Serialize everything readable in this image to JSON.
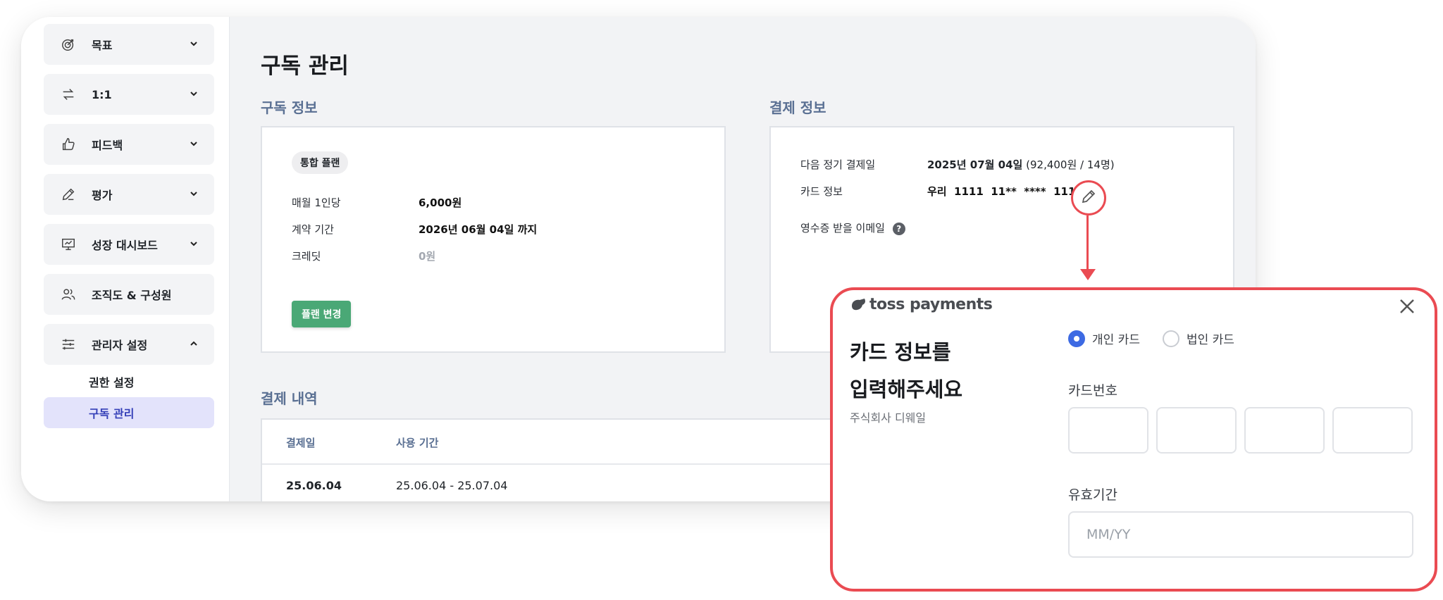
{
  "sidebar": {
    "items": [
      {
        "label": "목표",
        "icon": "target-icon",
        "expanded": false
      },
      {
        "label": "1:1",
        "icon": "swap-arrows-icon",
        "expanded": false
      },
      {
        "label": "피드백",
        "icon": "thumbs-up-icon",
        "expanded": false
      },
      {
        "label": "평가",
        "icon": "edit-pen-icon",
        "expanded": false
      },
      {
        "label": "성장 대시보드",
        "icon": "presentation-board-icon",
        "expanded": false
      },
      {
        "label": "조직도 & 구성원",
        "icon": "users-icon"
      },
      {
        "label": "관리자 설정",
        "icon": "sliders-icon",
        "expanded": true
      }
    ],
    "sub_items": [
      {
        "label": "권한 설정",
        "active": false
      },
      {
        "label": "구독 관리",
        "active": true
      }
    ]
  },
  "page": {
    "title": "구독 관리"
  },
  "subscription": {
    "section_title": "구독 정보",
    "plan_badge": "통합 플랜",
    "rows": [
      {
        "label": "매월 1인당",
        "value": "6,000원"
      },
      {
        "label": "계약 기간",
        "value": "2026년 06월 04일 까지"
      },
      {
        "label": "크레딧",
        "value": "0원"
      }
    ],
    "change_button": "플랜 변경"
  },
  "payment": {
    "section_title": "결제 정보",
    "next_payment_label": "다음 정기 결제일",
    "next_payment_date": "2025년 07월 04일",
    "next_payment_detail": "(92,400원 / 14명)",
    "card_label": "카드 정보",
    "card_value": "우리  1111  11**  ****  1111",
    "receipt_label": "영수증 받을 이메일",
    "help_glyph": "?"
  },
  "history": {
    "section_title": "결제 내역",
    "columns": [
      "결제일",
      "사용 기간"
    ],
    "rows": [
      {
        "date": "25.06.04",
        "period": "25.06.04 - 25.07.04"
      }
    ]
  },
  "popup": {
    "brand": "toss payments",
    "title_line1": "카드 정보를",
    "title_line2": "입력해주세요",
    "merchant": "주식회사 디웨일",
    "card_types": [
      {
        "label": "개인 카드",
        "checked": true
      },
      {
        "label": "법인 카드",
        "checked": false
      }
    ],
    "card_number_label": "카드번호",
    "expiry_label": "유효기간",
    "expiry_placeholder": "MM/YY"
  },
  "colors": {
    "accent_red": "#ea4b52",
    "green_button": "#4aa876",
    "active_nav_bg": "#e3e3fb",
    "radio_blue": "#3d6ae3",
    "section_title": "#5a7093"
  }
}
